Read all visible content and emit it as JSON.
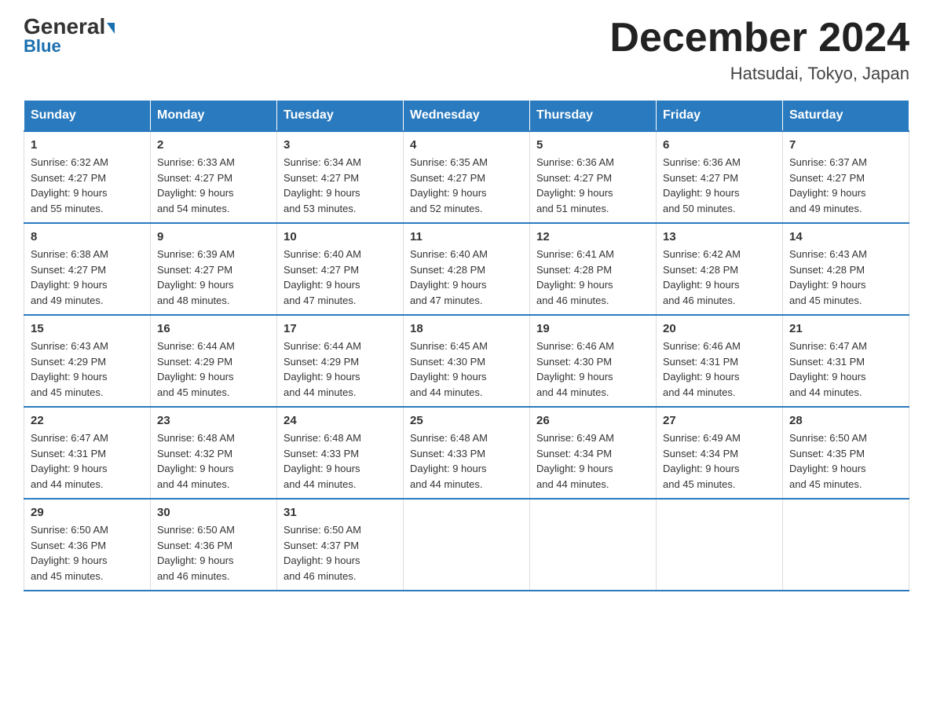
{
  "logo": {
    "general": "General",
    "blue": "Blue"
  },
  "header": {
    "month": "December 2024",
    "location": "Hatsudai, Tokyo, Japan"
  },
  "days_of_week": [
    "Sunday",
    "Monday",
    "Tuesday",
    "Wednesday",
    "Thursday",
    "Friday",
    "Saturday"
  ],
  "weeks": [
    [
      {
        "day": "1",
        "sunrise": "6:32 AM",
        "sunset": "4:27 PM",
        "daylight": "9 hours and 55 minutes."
      },
      {
        "day": "2",
        "sunrise": "6:33 AM",
        "sunset": "4:27 PM",
        "daylight": "9 hours and 54 minutes."
      },
      {
        "day": "3",
        "sunrise": "6:34 AM",
        "sunset": "4:27 PM",
        "daylight": "9 hours and 53 minutes."
      },
      {
        "day": "4",
        "sunrise": "6:35 AM",
        "sunset": "4:27 PM",
        "daylight": "9 hours and 52 minutes."
      },
      {
        "day": "5",
        "sunrise": "6:36 AM",
        "sunset": "4:27 PM",
        "daylight": "9 hours and 51 minutes."
      },
      {
        "day": "6",
        "sunrise": "6:36 AM",
        "sunset": "4:27 PM",
        "daylight": "9 hours and 50 minutes."
      },
      {
        "day": "7",
        "sunrise": "6:37 AM",
        "sunset": "4:27 PM",
        "daylight": "9 hours and 49 minutes."
      }
    ],
    [
      {
        "day": "8",
        "sunrise": "6:38 AM",
        "sunset": "4:27 PM",
        "daylight": "9 hours and 49 minutes."
      },
      {
        "day": "9",
        "sunrise": "6:39 AM",
        "sunset": "4:27 PM",
        "daylight": "9 hours and 48 minutes."
      },
      {
        "day": "10",
        "sunrise": "6:40 AM",
        "sunset": "4:27 PM",
        "daylight": "9 hours and 47 minutes."
      },
      {
        "day": "11",
        "sunrise": "6:40 AM",
        "sunset": "4:28 PM",
        "daylight": "9 hours and 47 minutes."
      },
      {
        "day": "12",
        "sunrise": "6:41 AM",
        "sunset": "4:28 PM",
        "daylight": "9 hours and 46 minutes."
      },
      {
        "day": "13",
        "sunrise": "6:42 AM",
        "sunset": "4:28 PM",
        "daylight": "9 hours and 46 minutes."
      },
      {
        "day": "14",
        "sunrise": "6:43 AM",
        "sunset": "4:28 PM",
        "daylight": "9 hours and 45 minutes."
      }
    ],
    [
      {
        "day": "15",
        "sunrise": "6:43 AM",
        "sunset": "4:29 PM",
        "daylight": "9 hours and 45 minutes."
      },
      {
        "day": "16",
        "sunrise": "6:44 AM",
        "sunset": "4:29 PM",
        "daylight": "9 hours and 45 minutes."
      },
      {
        "day": "17",
        "sunrise": "6:44 AM",
        "sunset": "4:29 PM",
        "daylight": "9 hours and 44 minutes."
      },
      {
        "day": "18",
        "sunrise": "6:45 AM",
        "sunset": "4:30 PM",
        "daylight": "9 hours and 44 minutes."
      },
      {
        "day": "19",
        "sunrise": "6:46 AM",
        "sunset": "4:30 PM",
        "daylight": "9 hours and 44 minutes."
      },
      {
        "day": "20",
        "sunrise": "6:46 AM",
        "sunset": "4:31 PM",
        "daylight": "9 hours and 44 minutes."
      },
      {
        "day": "21",
        "sunrise": "6:47 AM",
        "sunset": "4:31 PM",
        "daylight": "9 hours and 44 minutes."
      }
    ],
    [
      {
        "day": "22",
        "sunrise": "6:47 AM",
        "sunset": "4:31 PM",
        "daylight": "9 hours and 44 minutes."
      },
      {
        "day": "23",
        "sunrise": "6:48 AM",
        "sunset": "4:32 PM",
        "daylight": "9 hours and 44 minutes."
      },
      {
        "day": "24",
        "sunrise": "6:48 AM",
        "sunset": "4:33 PM",
        "daylight": "9 hours and 44 minutes."
      },
      {
        "day": "25",
        "sunrise": "6:48 AM",
        "sunset": "4:33 PM",
        "daylight": "9 hours and 44 minutes."
      },
      {
        "day": "26",
        "sunrise": "6:49 AM",
        "sunset": "4:34 PM",
        "daylight": "9 hours and 44 minutes."
      },
      {
        "day": "27",
        "sunrise": "6:49 AM",
        "sunset": "4:34 PM",
        "daylight": "9 hours and 45 minutes."
      },
      {
        "day": "28",
        "sunrise": "6:50 AM",
        "sunset": "4:35 PM",
        "daylight": "9 hours and 45 minutes."
      }
    ],
    [
      {
        "day": "29",
        "sunrise": "6:50 AM",
        "sunset": "4:36 PM",
        "daylight": "9 hours and 45 minutes."
      },
      {
        "day": "30",
        "sunrise": "6:50 AM",
        "sunset": "4:36 PM",
        "daylight": "9 hours and 46 minutes."
      },
      {
        "day": "31",
        "sunrise": "6:50 AM",
        "sunset": "4:37 PM",
        "daylight": "9 hours and 46 minutes."
      },
      null,
      null,
      null,
      null
    ]
  ],
  "labels": {
    "sunrise": "Sunrise:",
    "sunset": "Sunset:",
    "daylight": "Daylight:"
  }
}
